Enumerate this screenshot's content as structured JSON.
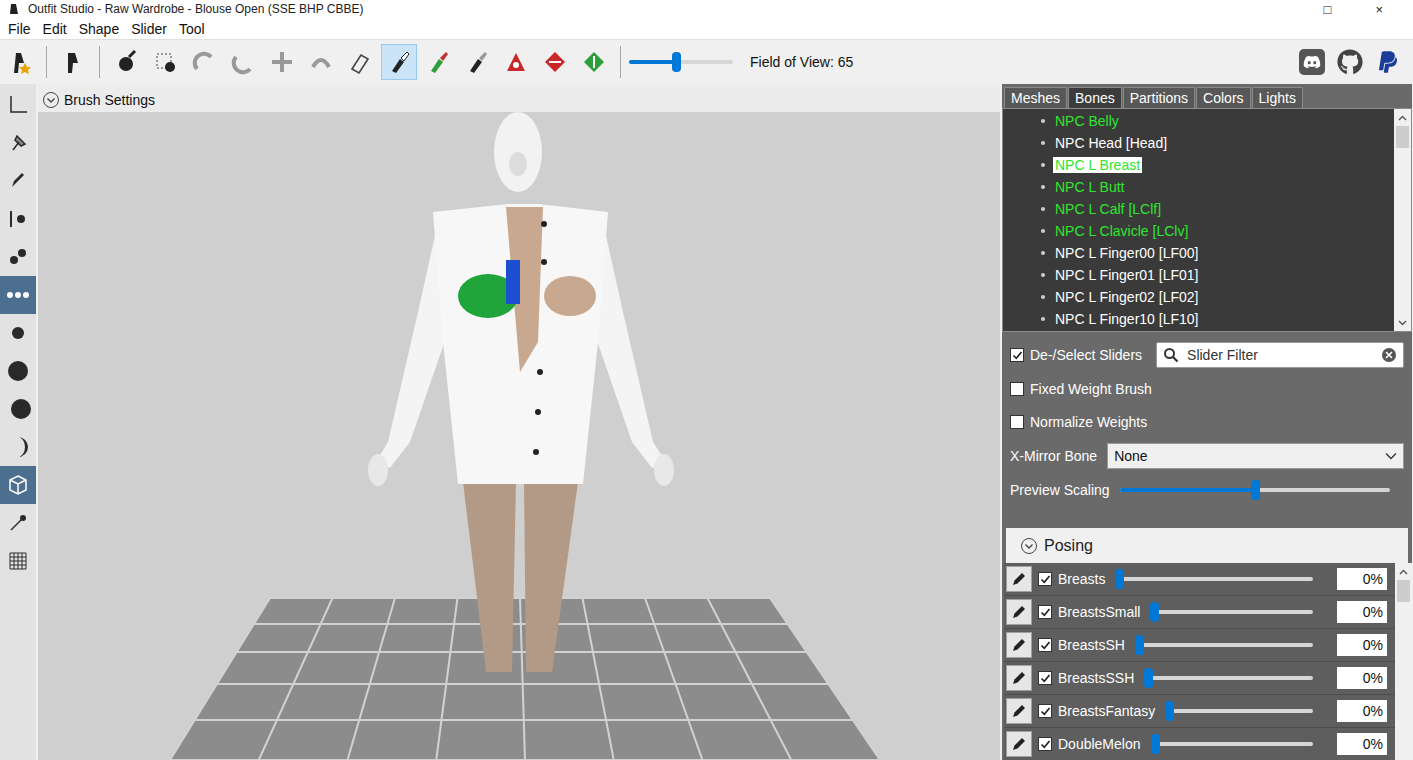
{
  "window": {
    "title": "Outfit Studio - Raw Wardrobe - Blouse Open (SSE BHP CBBE)",
    "controls": [
      "□",
      "×"
    ]
  },
  "menu": [
    "File",
    "Edit",
    "Shape",
    "Slider",
    "Tool"
  ],
  "toolbar": {
    "tools": [
      {
        "selected": false
      },
      {
        "selected": false
      },
      {
        "selected": false
      },
      {
        "selected": false
      },
      {
        "selected": false
      },
      {
        "selected": false
      },
      {
        "selected": false
      },
      {
        "selected": false
      },
      {
        "selected": false
      },
      {
        "selected": true
      },
      {
        "selected": false
      },
      {
        "selected": false
      },
      {
        "selected": false
      },
      {
        "selected": false
      },
      {
        "selected": false
      }
    ],
    "fov": {
      "label": "Field of View: 65",
      "level": 0.45
    }
  },
  "side_tools": [
    {
      "selected": false
    },
    {
      "selected": false
    },
    {
      "selected": false
    },
    {
      "selected": false
    },
    {
      "selected": false
    },
    {
      "selected": true
    },
    {
      "selected": false
    },
    {
      "selected": false
    },
    {
      "selected": false
    },
    {
      "selected": false
    },
    {
      "selected": true
    },
    {
      "selected": false
    },
    {
      "selected": false
    }
  ],
  "viewport": {
    "header": "Brush Settings"
  },
  "tabs": [
    {
      "label": "Meshes",
      "selected": false
    },
    {
      "label": "Bones",
      "selected": true
    },
    {
      "label": "Partitions",
      "selected": false
    },
    {
      "label": "Colors",
      "selected": false
    },
    {
      "label": "Lights",
      "selected": false
    }
  ],
  "bones": [
    {
      "name": "NPC Belly",
      "color": "#2ee62e",
      "selected": false
    },
    {
      "name": "NPC Head [Head]",
      "color": "#ffffff",
      "selected": false
    },
    {
      "name": "NPC L Breast",
      "color": "#2ee62e",
      "selected": true
    },
    {
      "name": "NPC L Butt",
      "color": "#2ee62e",
      "selected": false
    },
    {
      "name": "NPC L Calf [LClf]",
      "color": "#2ee62e",
      "selected": false
    },
    {
      "name": "NPC L Clavicle [LClv]",
      "color": "#2ee62e",
      "selected": false
    },
    {
      "name": "NPC L Finger00 [LF00]",
      "color": "#ffffff",
      "selected": false
    },
    {
      "name": "NPC L Finger01 [LF01]",
      "color": "#ffffff",
      "selected": false
    },
    {
      "name": "NPC L Finger02 [LF02]",
      "color": "#ffffff",
      "selected": false
    },
    {
      "name": "NPC L Finger10 [LF10]",
      "color": "#ffffff",
      "selected": false
    }
  ],
  "options": {
    "deselect_sliders": {
      "label": "De-/Select Sliders",
      "checked": true
    },
    "filter": {
      "placeholder": "Slider Filter"
    },
    "fixed_weight": {
      "label": "Fixed Weight Brush",
      "checked": false
    },
    "normalize": {
      "label": "Normalize Weights",
      "checked": false
    },
    "x_mirror": {
      "label": "X-Mirror Bone",
      "value": "None"
    },
    "preview_scaling": {
      "label": "Preview Scaling",
      "level": 0.5
    }
  },
  "posing": {
    "label": "Posing"
  },
  "sliders": [
    {
      "name": "Breasts",
      "checked": true,
      "level": 0,
      "reading": "0%"
    },
    {
      "name": "BreastsSmall",
      "checked": true,
      "level": 0,
      "reading": "0%"
    },
    {
      "name": "BreastsSH",
      "checked": true,
      "level": 0,
      "reading": "0%"
    },
    {
      "name": "BreastsSSH",
      "checked": true,
      "level": 0,
      "reading": "0%"
    },
    {
      "name": "BreastsFantasy",
      "checked": true,
      "level": 0,
      "reading": "0%"
    },
    {
      "name": "DoubleMelon",
      "checked": true,
      "level": 0,
      "reading": "0%"
    }
  ]
}
